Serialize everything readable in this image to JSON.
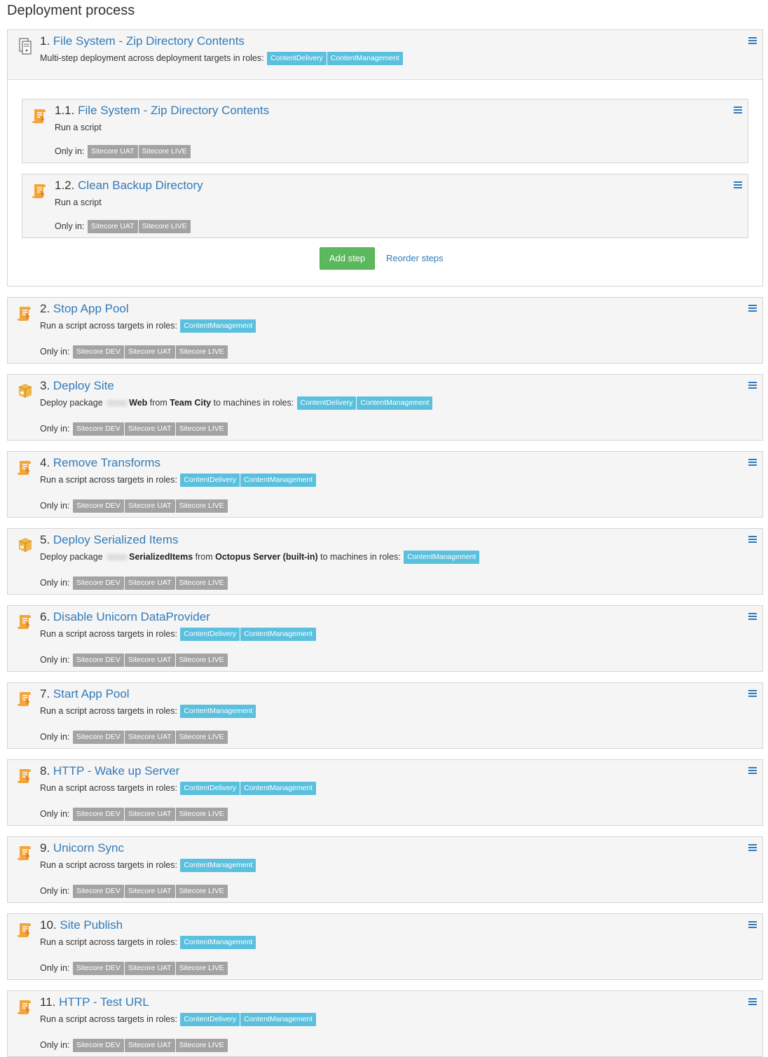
{
  "page_title": "Deployment process",
  "labels": {
    "only_in": "Only in:",
    "add_step": "Add step",
    "reorder_steps": "Reorder steps"
  },
  "colors": {
    "link": "#337ab7",
    "role_badge": "#5bc0de",
    "env_badge": "#a3a3a3",
    "add_button": "#5cb85c"
  },
  "parent_step": {
    "number": "1.",
    "name": "File System - Zip Directory Contents",
    "icon": "multi-step-server-icon",
    "description": "Multi-step deployment across deployment targets in roles:",
    "roles": [
      "ContentDelivery",
      "ContentManagement"
    ],
    "children": [
      {
        "number": "1.1.",
        "name": "File System - Zip Directory Contents",
        "icon": "script-icon",
        "description": "Run a script",
        "environments": [
          "Sitecore UAT",
          "Sitecore LIVE"
        ]
      },
      {
        "number": "1.2.",
        "name": "Clean Backup Directory",
        "icon": "script-icon",
        "description": "Run a script",
        "environments": [
          "Sitecore UAT",
          "Sitecore LIVE"
        ]
      }
    ]
  },
  "steps": [
    {
      "number": "2.",
      "name": "Stop App Pool",
      "icon": "script-icon",
      "desc_pre": "Run a script across targets in roles:",
      "roles": [
        "ContentManagement"
      ],
      "environments": [
        "Sitecore DEV",
        "Sitecore UAT",
        "Sitecore LIVE"
      ]
    },
    {
      "number": "3.",
      "name": "Deploy Site",
      "icon": "package-icon",
      "desc_pre": "Deploy package",
      "package": "Web",
      "desc_from": "from",
      "feed": "Team City",
      "desc_post": "to machines in roles:",
      "roles": [
        "ContentDelivery",
        "ContentManagement"
      ],
      "environments": [
        "Sitecore DEV",
        "Sitecore UAT",
        "Sitecore LIVE"
      ]
    },
    {
      "number": "4.",
      "name": "Remove Transforms",
      "icon": "script-icon",
      "desc_pre": "Run a script across targets in roles:",
      "roles": [
        "ContentDelivery",
        "ContentManagement"
      ],
      "environments": [
        "Sitecore DEV",
        "Sitecore UAT",
        "Sitecore LIVE"
      ]
    },
    {
      "number": "5.",
      "name": "Deploy Serialized Items",
      "icon": "package-icon",
      "desc_pre": "Deploy package",
      "package": "SerializedItems",
      "desc_from": "from",
      "feed": "Octopus Server (built-in)",
      "desc_post": "to machines in roles:",
      "roles": [
        "ContentManagement"
      ],
      "environments": [
        "Sitecore DEV",
        "Sitecore UAT",
        "Sitecore LIVE"
      ]
    },
    {
      "number": "6.",
      "name": "Disable Unicorn DataProvider",
      "icon": "script-icon",
      "desc_pre": "Run a script across targets in roles:",
      "roles": [
        "ContentDelivery",
        "ContentManagement"
      ],
      "environments": [
        "Sitecore DEV",
        "Sitecore UAT",
        "Sitecore LIVE"
      ]
    },
    {
      "number": "7.",
      "name": "Start App Pool",
      "icon": "script-icon",
      "desc_pre": "Run a script across targets in roles:",
      "roles": [
        "ContentManagement"
      ],
      "environments": [
        "Sitecore DEV",
        "Sitecore UAT",
        "Sitecore LIVE"
      ]
    },
    {
      "number": "8.",
      "name": "HTTP - Wake up Server",
      "icon": "script-icon",
      "desc_pre": "Run a script across targets in roles:",
      "roles": [
        "ContentDelivery",
        "ContentManagement"
      ],
      "environments": [
        "Sitecore DEV",
        "Sitecore UAT",
        "Sitecore LIVE"
      ]
    },
    {
      "number": "9.",
      "name": "Unicorn Sync",
      "icon": "script-icon",
      "desc_pre": "Run a script across targets in roles:",
      "roles": [
        "ContentManagement"
      ],
      "environments": [
        "Sitecore DEV",
        "Sitecore UAT",
        "Sitecore LIVE"
      ]
    },
    {
      "number": "10.",
      "name": "Site Publish",
      "icon": "script-icon",
      "desc_pre": "Run a script across targets in roles:",
      "roles": [
        "ContentManagement"
      ],
      "environments": [
        "Sitecore DEV",
        "Sitecore UAT",
        "Sitecore LIVE"
      ]
    },
    {
      "number": "11.",
      "name": "HTTP - Test URL",
      "icon": "script-icon",
      "desc_pre": "Run a script across targets in roles:",
      "roles": [
        "ContentDelivery",
        "ContentManagement"
      ],
      "environments": [
        "Sitecore DEV",
        "Sitecore UAT",
        "Sitecore LIVE"
      ]
    }
  ]
}
